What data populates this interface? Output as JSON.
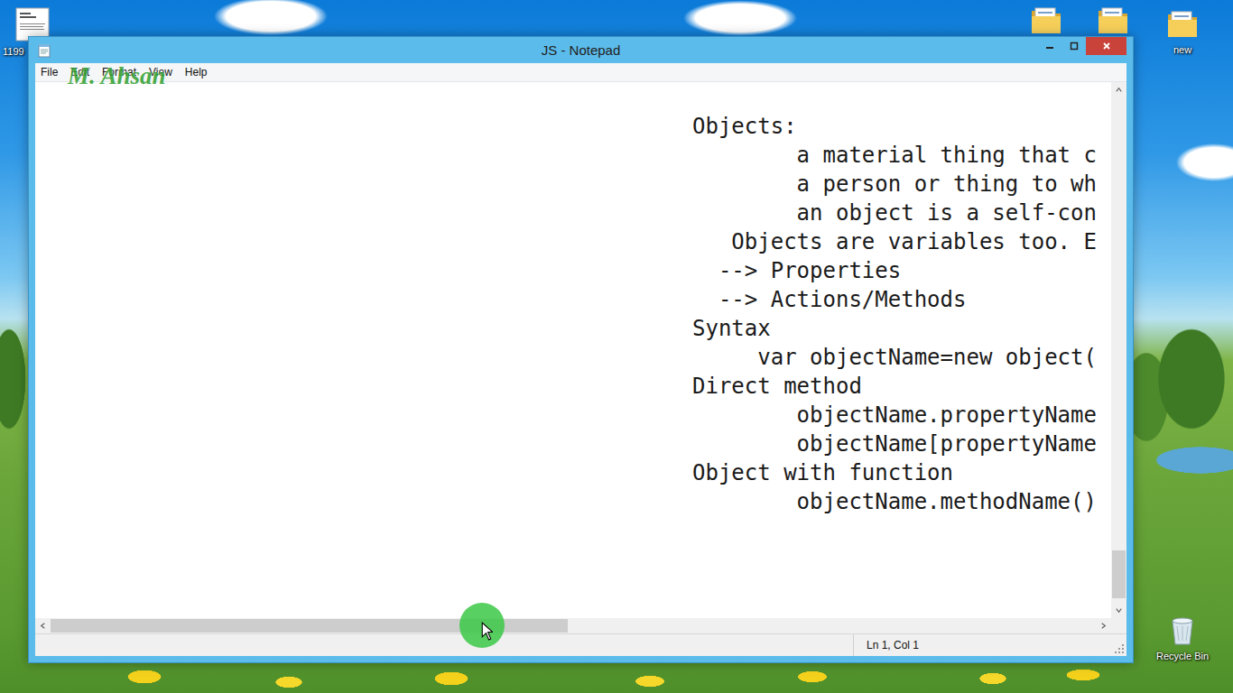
{
  "desktop": {
    "icons": [
      {
        "kind": "document",
        "label": "1199"
      },
      {
        "kind": "folder",
        "label": ""
      },
      {
        "kind": "folder",
        "label": ""
      },
      {
        "kind": "folder",
        "label": "new"
      },
      {
        "kind": "recycle-bin",
        "label": "Recycle Bin"
      }
    ]
  },
  "window": {
    "title": "JS - Notepad",
    "menu": [
      "File",
      "Edit",
      "Format",
      "View",
      "Help"
    ],
    "watermark": "M. Ahsan",
    "lines": [
      "Objects:",
      "        a material thing that c",
      "        a person or thing to wh",
      "        an object is a self-con",
      "   Objects are variables too. E",
      "  --> Properties",
      "  --> Actions/Methods",
      "Syntax",
      "     var objectName=new object(",
      "Direct method",
      "        objectName.propertyName",
      "        objectName[propertyName",
      "Object with function",
      "        objectName.methodName()"
    ],
    "scrollbars": {
      "vertical": {
        "level": 0.99,
        "thumb": 0.095
      },
      "horizontal": {
        "level": 0,
        "thumb": 0.495
      }
    },
    "status_bar": {
      "position": "Ln 1, Col 1"
    }
  }
}
